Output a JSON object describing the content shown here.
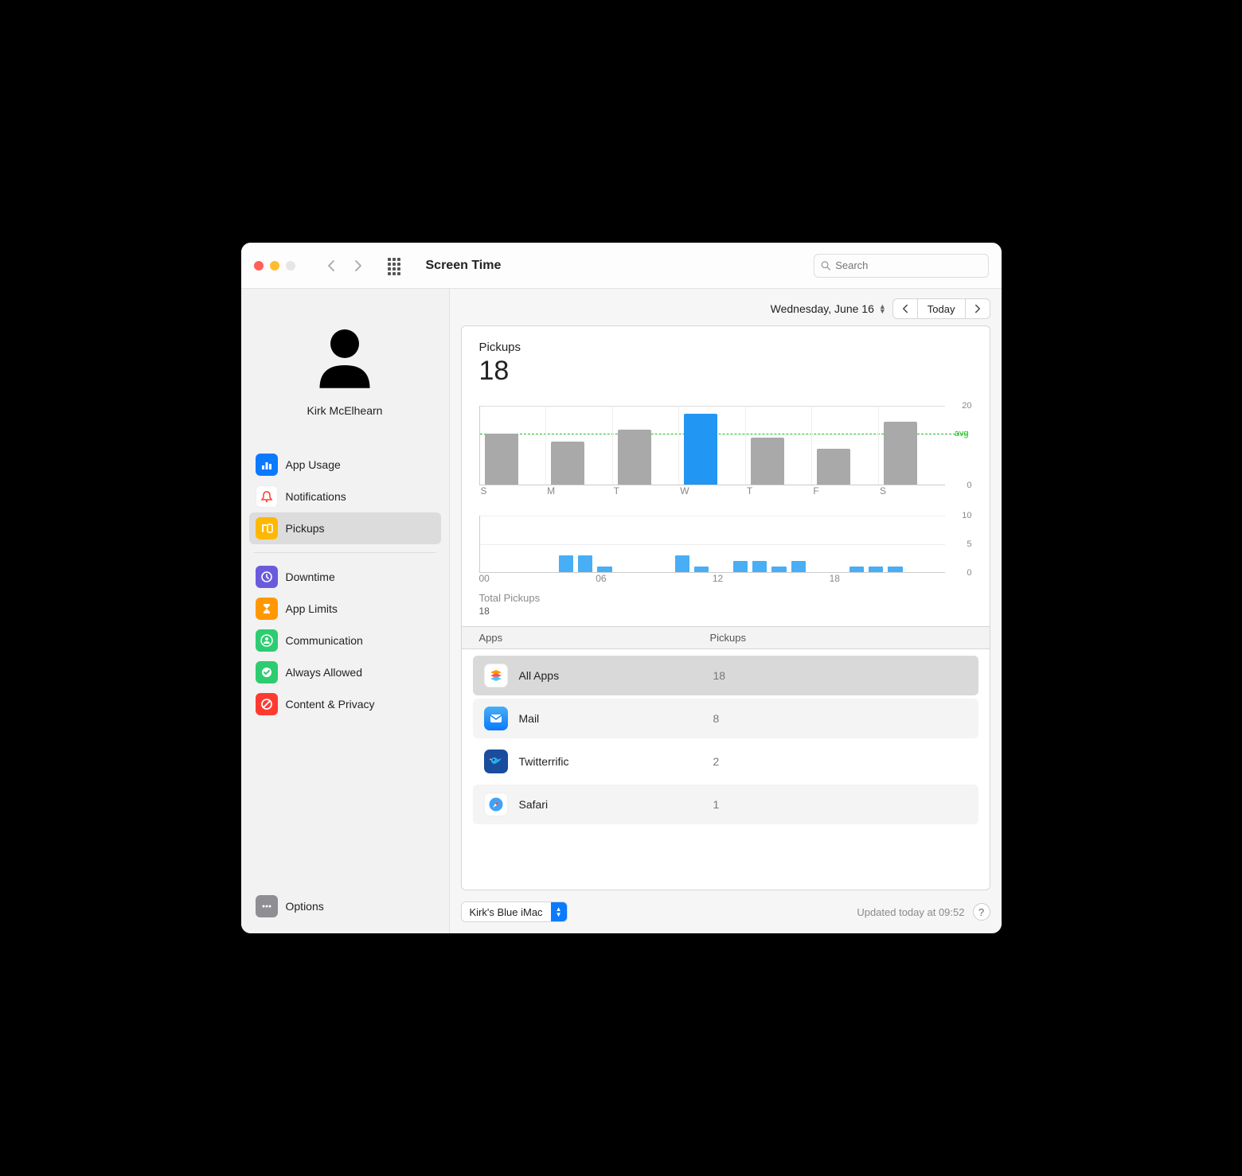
{
  "window": {
    "title": "Screen Time",
    "search_placeholder": "Search"
  },
  "user": {
    "name": "Kirk McElhearn"
  },
  "sidebar": {
    "items": [
      {
        "id": "app-usage",
        "label": "App Usage",
        "color": "#0a7aff"
      },
      {
        "id": "notifications",
        "label": "Notifications",
        "color": "#ffffff"
      },
      {
        "id": "pickups",
        "label": "Pickups",
        "color": "#ffb800",
        "selected": true
      },
      {
        "id": "downtime",
        "label": "Downtime",
        "color": "#6a5bdc"
      },
      {
        "id": "app-limits",
        "label": "App Limits",
        "color": "#ff9800"
      },
      {
        "id": "communication",
        "label": "Communication",
        "color": "#2ecc71"
      },
      {
        "id": "always-allowed",
        "label": "Always Allowed",
        "color": "#2ecc71"
      },
      {
        "id": "content-privacy",
        "label": "Content & Privacy",
        "color": "#ff3b30"
      }
    ],
    "options_label": "Options"
  },
  "date_nav": {
    "date_label": "Wednesday, June 16",
    "today_label": "Today"
  },
  "pickups": {
    "title": "Pickups",
    "value": "18",
    "total_label": "Total Pickups",
    "total_value": "18"
  },
  "table_header": {
    "apps": "Apps",
    "pickups": "Pickups"
  },
  "apps": [
    {
      "id": "all",
      "name": "All Apps",
      "count": "18"
    },
    {
      "id": "mail",
      "name": "Mail",
      "count": "8"
    },
    {
      "id": "twitterrific",
      "name": "Twitterrific",
      "count": "2"
    },
    {
      "id": "safari",
      "name": "Safari",
      "count": "1"
    }
  ],
  "footer": {
    "device": "Kirk's Blue iMac",
    "updated": "Updated today at 09:52",
    "help": "?"
  },
  "chart_data": [
    {
      "name": "weekly",
      "type": "bar",
      "categories": [
        "S",
        "M",
        "T",
        "W",
        "T",
        "F",
        "S"
      ],
      "values": [
        13,
        11,
        14,
        18,
        12,
        9,
        16
      ],
      "ylim": [
        0,
        20
      ],
      "avg": 13,
      "avg_label": "avg",
      "ylabel": "",
      "highlight_index": 3,
      "yticks": [
        {
          "v": 0,
          "l": "0"
        },
        {
          "v": 20,
          "l": "20"
        }
      ]
    },
    {
      "name": "hourly",
      "type": "bar",
      "x_ticks_visible": [
        "00",
        "06",
        "12",
        "18"
      ],
      "values": [
        0,
        0,
        0,
        0,
        3,
        3,
        1,
        0,
        0,
        0,
        3,
        1,
        0,
        2,
        2,
        1,
        2,
        0,
        0,
        1,
        1,
        1,
        0,
        0
      ],
      "ylim": [
        0,
        10
      ],
      "yticks": [
        {
          "v": 0,
          "l": "0"
        },
        {
          "v": 5,
          "l": "5"
        },
        {
          "v": 10,
          "l": "10"
        }
      ]
    }
  ]
}
